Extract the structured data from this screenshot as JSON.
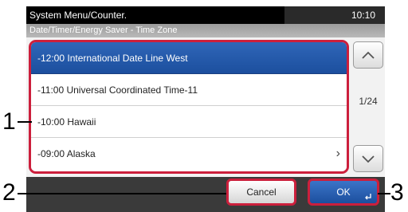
{
  "header": {
    "title": "System Menu/Counter.",
    "time": "10:10",
    "breadcrumb": "Date/Timer/Energy Saver - Time Zone"
  },
  "list": {
    "items": [
      {
        "label": "-12:00 International Date Line West",
        "selected": true
      },
      {
        "label": "-11:00 Universal Coordinated Time-11",
        "selected": false
      },
      {
        "label": "-10:00 Hawaii",
        "selected": false
      },
      {
        "label": "-09:00 Alaska",
        "selected": false
      }
    ]
  },
  "pagination": {
    "page": "1/24"
  },
  "buttons": {
    "cancel": "Cancel",
    "ok": "OK"
  },
  "callouts": {
    "one": "1",
    "two": "2",
    "three": "3"
  },
  "colors": {
    "highlight": "#cc1f3c",
    "selected": "#1c4f9e"
  }
}
